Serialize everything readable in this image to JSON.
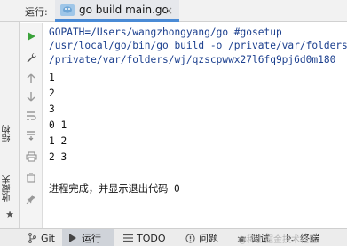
{
  "tabbar": {
    "run_label": "运行:",
    "tab_label": "go build main.go",
    "close_glyph": "×"
  },
  "left_strip": {
    "structure_label": "结构",
    "favorites_label": "收藏夹"
  },
  "console": {
    "lines": [
      "GOPATH=/Users/wangzhongyang/go #gosetup",
      "/usr/local/go/bin/go build -o /private/var/folders/wj/qz",
      "/private/var/folders/wj/qzscpwwx27l6fq9pj6d0m180",
      "1",
      "2",
      "3",
      "0 1",
      "1 2",
      "2 3",
      "",
      "进程完成，并显示退出代码 0"
    ]
  },
  "bottombar": {
    "git": "Git",
    "run": "运行",
    "todo": "TODO",
    "problems": "问题",
    "debug": "调试",
    "terminal": "终端",
    "watermark": "@稀土掘金技术社区"
  },
  "colors": {
    "accent": "#4a8bd6",
    "run_green": "#3ba23b",
    "command_text": "#1b3f8e"
  }
}
